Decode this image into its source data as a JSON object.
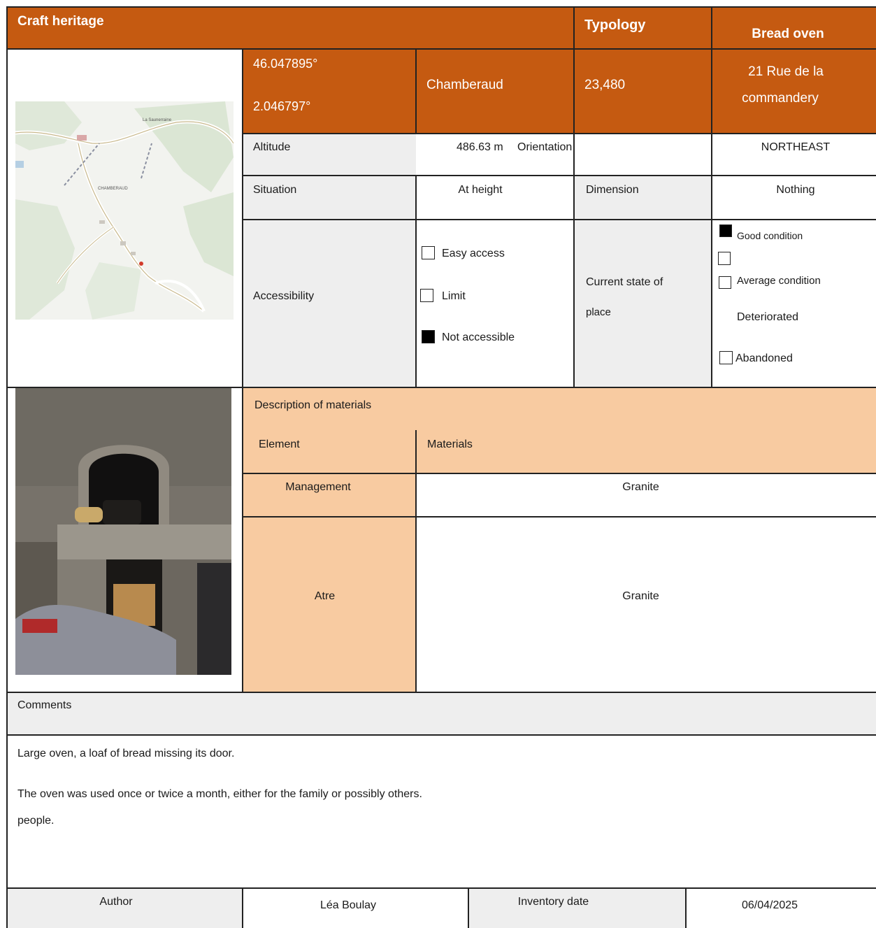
{
  "header": {
    "title": "Craft heritage",
    "typology_label": "Typology",
    "typology_value": "Bread oven"
  },
  "location": {
    "latitude": "46.047895°",
    "longitude": "2.046797°",
    "commune": "Chamberaud",
    "postal_code": "23,480",
    "address_line1": "21 Rue de la",
    "address_line2": "commandery"
  },
  "map": {
    "labels": [
      "La Saunerraine",
      "CHAMBERAUD"
    ]
  },
  "altitude": {
    "label": "Altitude",
    "value": "486.63 m",
    "orientation_label": "Orientation",
    "orientation_value": "NORTHEAST"
  },
  "situation": {
    "label": "Situation",
    "value": "At height",
    "dimension_label": "Dimension",
    "dimension_value": "Nothing"
  },
  "accessibility": {
    "label": "Accessibility",
    "options": [
      {
        "label": "Easy access",
        "checked": false
      },
      {
        "label": "Limit",
        "checked": false
      },
      {
        "label": "Not accessible",
        "checked": true
      }
    ]
  },
  "state": {
    "label_line1": "Current state of",
    "label_line2": "place",
    "options": [
      {
        "label": "Good condition",
        "checked": true
      },
      {
        "label": "",
        "checked": false
      },
      {
        "label": "Average condition",
        "checked": false
      },
      {
        "label": "Deteriorated",
        "checked": false
      },
      {
        "label": "Abandoned",
        "checked": false
      }
    ]
  },
  "materials": {
    "section_title": "Description of materials",
    "col_element": "Element",
    "col_materials": "Materials",
    "rows": [
      {
        "element": "Management",
        "material": "Granite"
      },
      {
        "element": "Atre",
        "material": "Granite"
      }
    ]
  },
  "comments": {
    "label": "Comments",
    "lines": [
      "Large oven, a loaf of bread missing its door.",
      "The oven was used once or twice a month, either for the family or possibly others.",
      "people."
    ]
  },
  "footer": {
    "author_label": "Author",
    "author_value": "Léa Boulay",
    "date_label": "Inventory date",
    "date_value": "06/04/2025"
  },
  "colors": {
    "header_orange": "#c55a11",
    "peach": "#f8cba1",
    "grey": "#eeeeee"
  }
}
